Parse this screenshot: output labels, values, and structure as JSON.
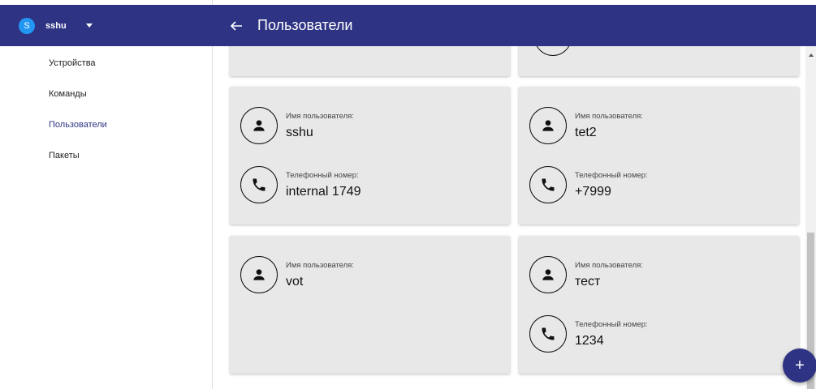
{
  "account": {
    "initial": "S",
    "name": "sshu"
  },
  "nav": {
    "items": [
      {
        "label": "Устройства"
      },
      {
        "label": "Команды"
      },
      {
        "label": "Пользователи"
      },
      {
        "label": "Пакеты"
      }
    ]
  },
  "header": {
    "title": "Пользователи"
  },
  "users": [
    {
      "name_label": "Имя пользователя:",
      "name": "sshu",
      "phone_label": "Телефонный номер:",
      "phone": "internal 1749"
    },
    {
      "name_label": "Имя пользователя:",
      "name": "tet2",
      "phone_label": "Телефонный номер:",
      "phone": "+7999"
    },
    {
      "name_label": "Имя пользователя:",
      "name": "vot"
    },
    {
      "name_label": "Имя пользователя:",
      "name": "тест",
      "phone_label": "Телефонный номер:",
      "phone": "1234"
    }
  ],
  "fab": {
    "label": "+"
  },
  "colors": {
    "primary": "#2e3483",
    "avatar": "#2196f3",
    "card": "#e8e8e8",
    "active_nav": "#2e3483"
  },
  "icons": {
    "back": "arrow-left-icon",
    "account_caret": "caret-down-icon",
    "user": "person-icon",
    "phone": "phone-icon",
    "add": "plus-icon"
  }
}
